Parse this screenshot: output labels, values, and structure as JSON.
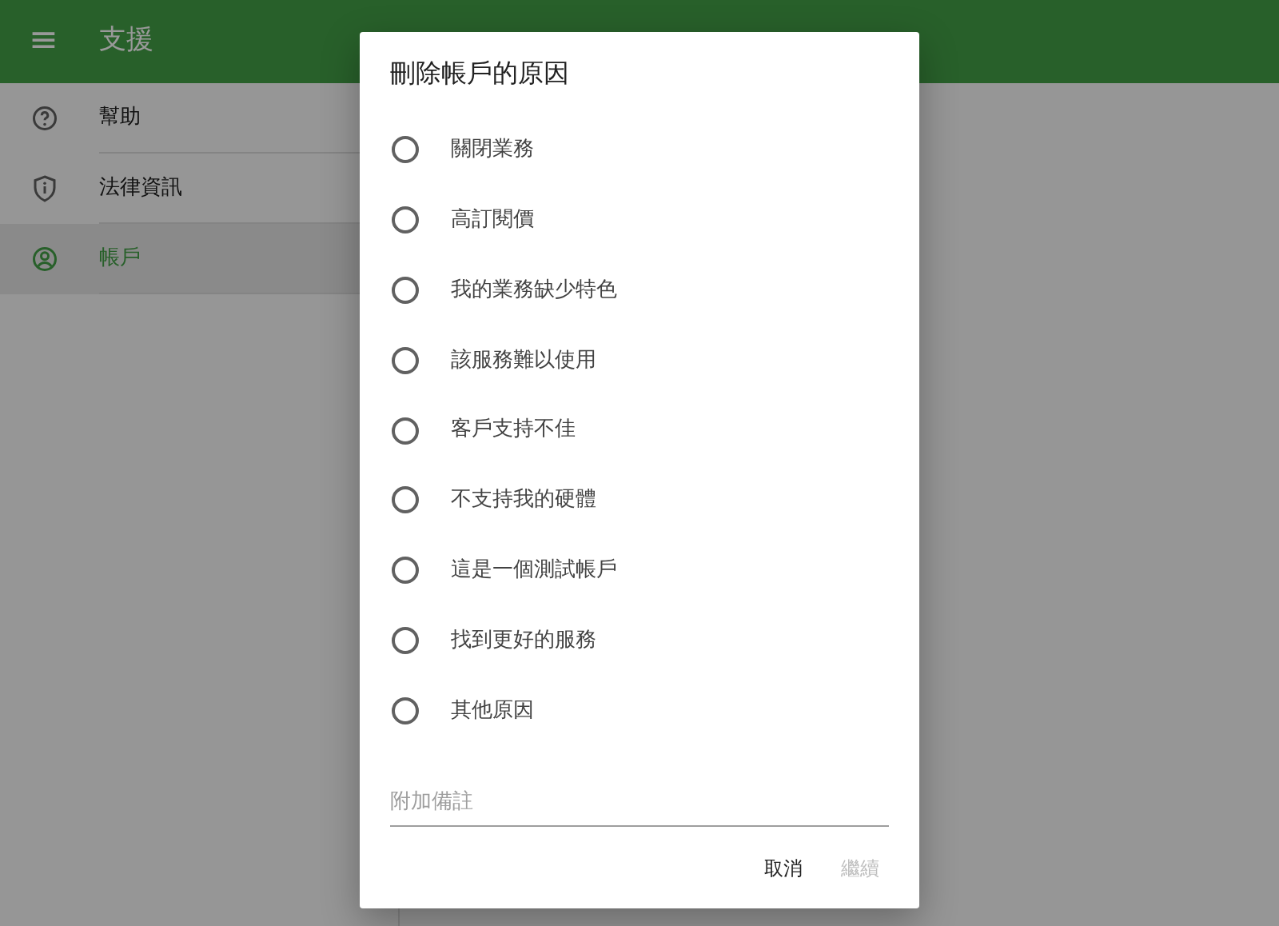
{
  "app_bar": {
    "menu_icon": "≡",
    "title": "支援"
  },
  "sidebar": {
    "items": [
      {
        "label": "幫助",
        "kind": "help",
        "selected": false
      },
      {
        "label": "法律資訊",
        "kind": "legal",
        "selected": false
      },
      {
        "label": "帳戶",
        "kind": "account",
        "selected": true
      }
    ]
  },
  "dialog": {
    "title": "刪除帳戶的原因",
    "options": [
      {
        "label": "關閉業務",
        "selected": false
      },
      {
        "label": "高訂閱價",
        "selected": false
      },
      {
        "label": "我的業務缺少特色",
        "selected": false
      },
      {
        "label": "該服務難以使用",
        "selected": false
      },
      {
        "label": "客戶支持不佳",
        "selected": false
      },
      {
        "label": "不支持我的硬體",
        "selected": false
      },
      {
        "label": "這是一個測試帳戶",
        "selected": false
      },
      {
        "label": "找到更好的服務",
        "selected": false
      },
      {
        "label": "其他原因",
        "selected": false
      }
    ],
    "notes_field": {
      "placeholder": "附加備註"
    },
    "buttons": [
      {
        "label": "取消",
        "disabled": false
      },
      {
        "label": "繼續",
        "disabled": true
      }
    ]
  }
}
